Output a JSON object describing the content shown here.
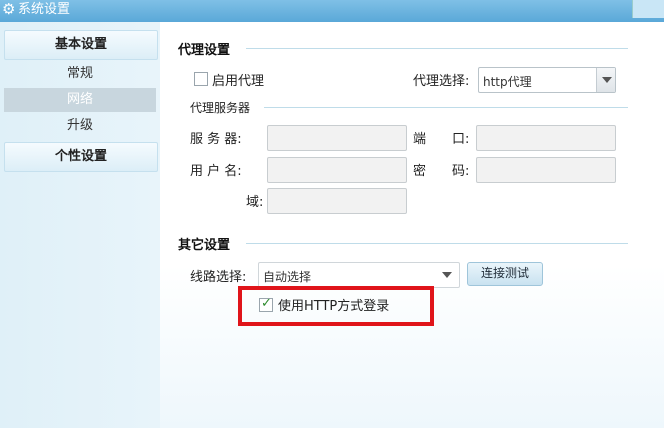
{
  "window": {
    "title": "系统设置",
    "icon": "gear-icon"
  },
  "sidebar": {
    "sections": [
      {
        "label": "基本设置",
        "items": [
          "常规",
          "网络",
          "升级"
        ],
        "selected": "网络"
      },
      {
        "label": "个性设置"
      }
    ]
  },
  "proxy": {
    "section_title": "代理设置",
    "enable_label": "启用代理",
    "enable_checked": false,
    "select_label": "代理选择:",
    "select_value": "http代理",
    "server_subtitle": "代理服务器",
    "server_label": "服 务 器:",
    "port_label": "端　　口:",
    "user_label": "用 户 名:",
    "password_label": "密　　码:",
    "domain_label": "域:",
    "server_value": "",
    "port_value": "",
    "user_value": "",
    "password_value": "",
    "domain_value": ""
  },
  "other": {
    "section_title": "其它设置",
    "route_label": "线路选择:",
    "route_value": "自动选择",
    "test_button": "连接测试",
    "http_login_label": "使用HTTP方式登录",
    "http_login_checked": true
  },
  "colors": {
    "highlight": "#e0141a",
    "selected_item_bg": "#c8d6de"
  }
}
